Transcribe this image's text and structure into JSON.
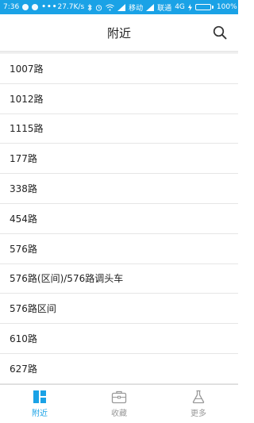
{
  "status_bar": {
    "time": "7:36",
    "speed": "27.7K/s",
    "carrier1": "移动",
    "carrier2": "联通",
    "network": "4G",
    "battery": "100%"
  },
  "header": {
    "title": "附近"
  },
  "routes": [
    "1007路",
    "1012路",
    "1115路",
    "177路",
    "338路",
    "454路",
    "576路",
    "576路(区间)/576路调头车",
    "576路区间",
    "610路",
    "627路"
  ],
  "tabs": [
    {
      "label": "附近",
      "icon": "nearby-icon",
      "active": true
    },
    {
      "label": "收藏",
      "icon": "briefcase-icon",
      "active": false
    },
    {
      "label": "更多",
      "icon": "flask-icon",
      "active": false
    }
  ],
  "colors": {
    "accent": "#1aa2e6",
    "inactive": "#999999"
  }
}
